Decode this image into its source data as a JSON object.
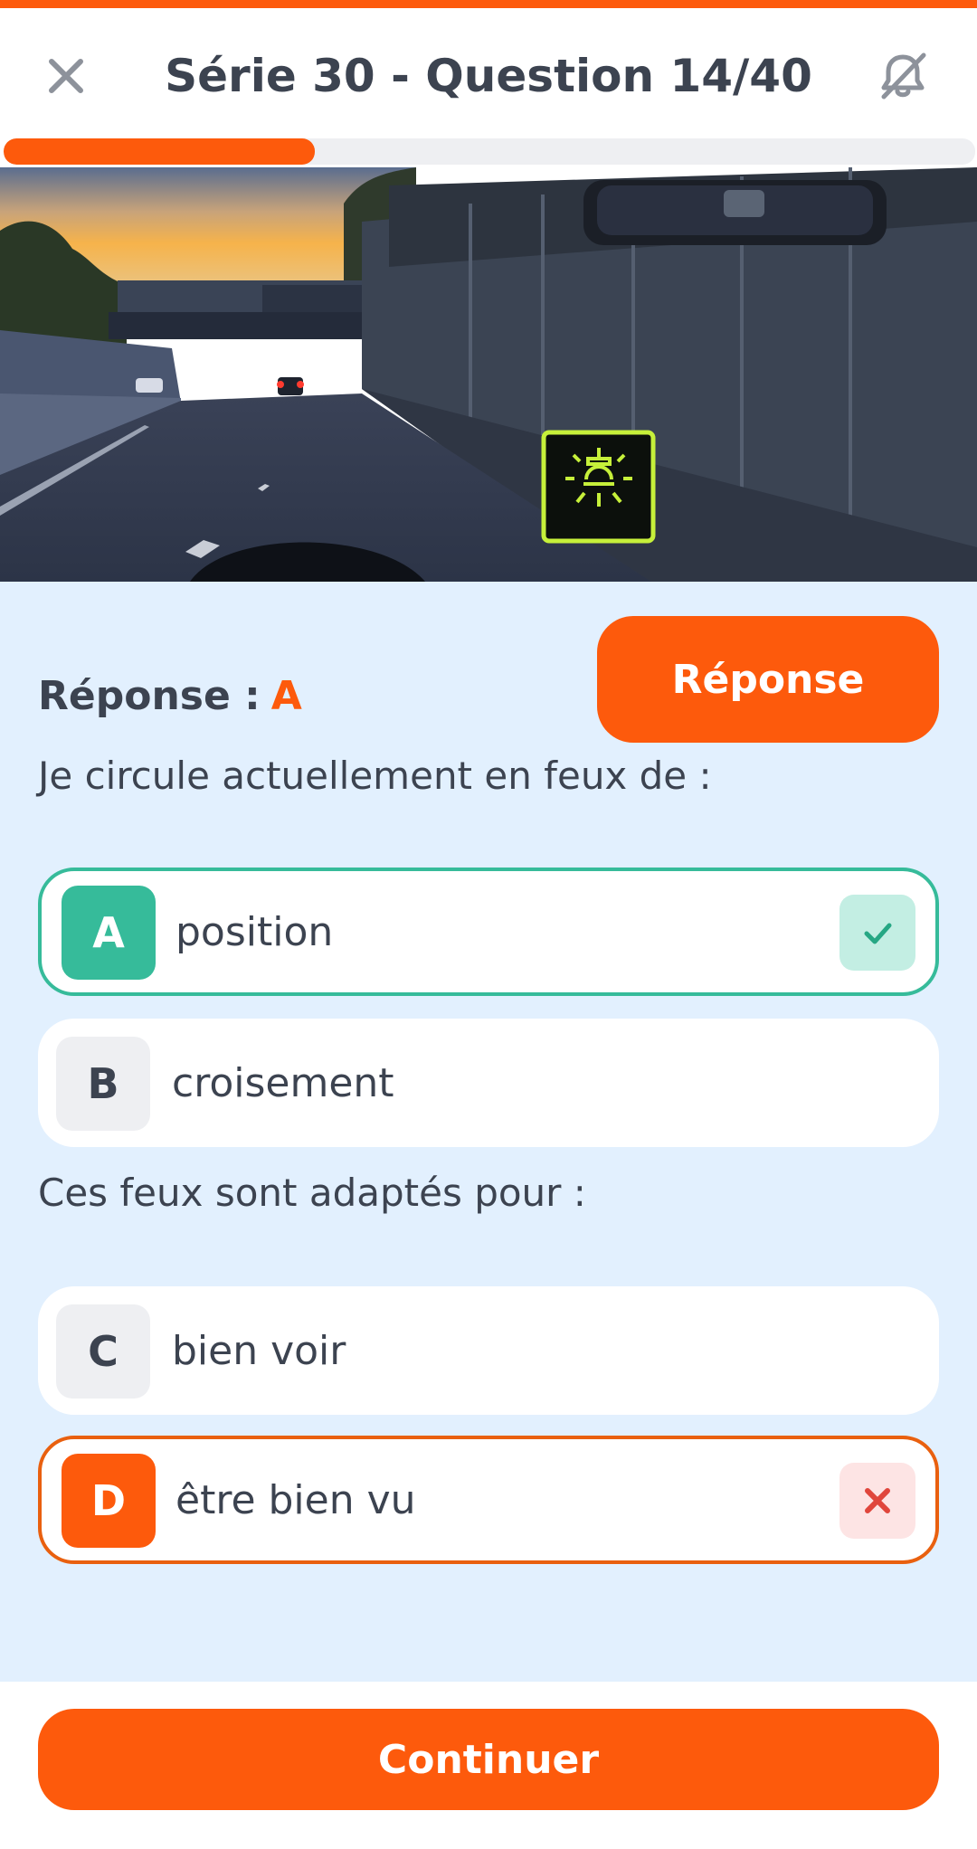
{
  "header": {
    "title": "Série 30 - Question 14/40",
    "close_icon": "close-icon",
    "sound_icon": "sound-off-icon"
  },
  "progress": {
    "current": 14,
    "total": 40,
    "fraction": 0.32
  },
  "scene": {
    "description_icon": "headlight-indicator-icon",
    "indicator_color": "#c6f03a"
  },
  "answer": {
    "label": "Réponse :",
    "value": "A",
    "button_label": "Réponse"
  },
  "questions": [
    {
      "text": "Je circule actuellement en feux de :",
      "options": [
        {
          "letter": "A",
          "text": "position",
          "state": "correct"
        },
        {
          "letter": "B",
          "text": "croisement",
          "state": "neutral"
        }
      ]
    },
    {
      "text": "Ces feux sont adaptés pour :",
      "options": [
        {
          "letter": "C",
          "text": "bien voir",
          "state": "neutral"
        },
        {
          "letter": "D",
          "text": "être bien vu",
          "state": "wrong"
        }
      ]
    }
  ],
  "footer": {
    "continue_label": "Continuer"
  },
  "colors": {
    "accent": "#fd5a0c",
    "correct": "#36bb9a",
    "wrong": "#e9600f",
    "background": "#e2f0fe"
  }
}
